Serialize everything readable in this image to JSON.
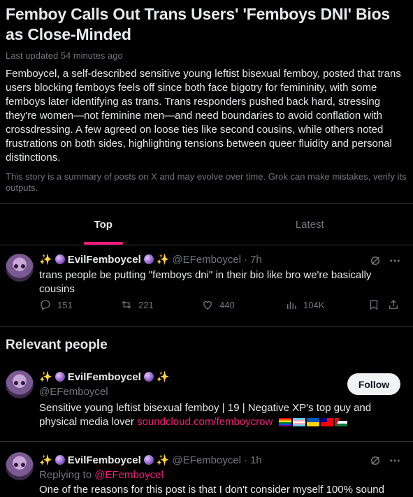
{
  "story": {
    "title": "Femboy Calls Out Trans Users' 'Femboys DNI' Bios as Close-Minded",
    "updated": "Last updated 54 minutes ago",
    "summary": "Femboycel, a self-described sensitive young leftist bisexual femboy, posted that trans users blocking femboys feels off since both face bigotry for femininity, with some femboys later identifying as trans. Trans responders pushed back hard, stressing they're women—not feminine men—and need boundaries to avoid conflation with crossdressing. A few agreed on loose ties like second cousins, while others noted frustrations on both sides, highlighting tensions between queer fluidity and personal distinctions.",
    "disclaimer": "This story is a summary of posts on X and may evolve over time. Grok can make mistakes, verify its outputs."
  },
  "tabs": [
    {
      "label": "Top",
      "active": true
    },
    {
      "label": "Latest",
      "active": false
    }
  ],
  "post1": {
    "display_name": "EvilFemboycel",
    "handle": "@EFemboycel",
    "time": "7h",
    "text": "trans people be putting \"femboys dni\" in their bio like bro we're basically cousins",
    "replies": "151",
    "reposts": "221",
    "likes": "440",
    "views": "104K"
  },
  "relevant": {
    "title": "Relevant people",
    "display_name": "EvilFemboycel",
    "handle": "@EFemboycel",
    "follow_label": "Follow",
    "bio": "Sensitive young leftist bisexual femboy | 19 | Negative XP's top guy and physical media lover",
    "bio_link": "soundcloud.com/femboycrow"
  },
  "post2": {
    "display_name": "EvilFemboycel",
    "handle": "@EFemboycel",
    "time": "1h",
    "replying_prefix": "Replying to",
    "replying_to": "@EFemboycel",
    "text": "One of the reasons for this post is that I don't consider myself 100% sound"
  },
  "icons": {
    "emoji_prefix": [
      "sparkles-icon",
      "crystal-ball-icon"
    ],
    "emoji_suffix": [
      "crystal-ball-icon",
      "sparkles-icon"
    ],
    "flags": [
      "rainbow-flag",
      "transgender-flag",
      "ukraine-flag",
      "taiwan-flag",
      "palestine-flag"
    ]
  },
  "colors": {
    "accent": "#f91880",
    "muted": "#71767b",
    "text": "#e7e9ea",
    "border": "#2f3336"
  }
}
